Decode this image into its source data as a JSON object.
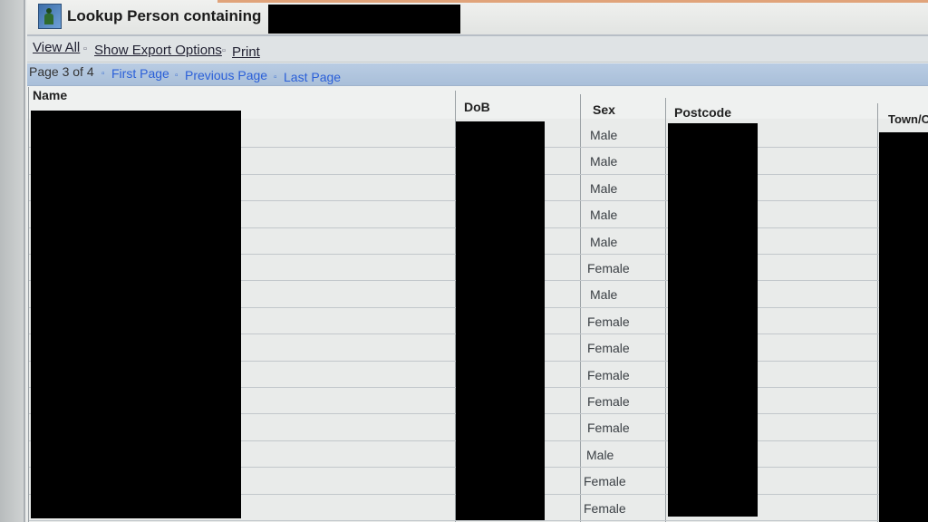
{
  "window": {
    "title": "Lookup Person containing"
  },
  "toolbar": {
    "view_all": "View All",
    "show_export": "Show Export Options",
    "print": "Print"
  },
  "pager": {
    "status": "Page 3 of 4",
    "first": "First Page",
    "previous": "Previous Page",
    "last": "Last Page"
  },
  "table": {
    "columns": {
      "name": "Name",
      "dob": "DoB",
      "sex": "Sex",
      "postcode": "Postcode",
      "town": "Town/C"
    },
    "sex_values": [
      "Male",
      "Male",
      "Male",
      "Male",
      "Male",
      "Female",
      "Male",
      "Female",
      "Female",
      "Female",
      "Female",
      "Female",
      "Male",
      "Female",
      "Female"
    ]
  },
  "colors": {
    "link": "#2a5fd8",
    "pager_bg": "#b9cce3",
    "redaction": "#000000"
  },
  "icons": {
    "app": "person-icon"
  }
}
